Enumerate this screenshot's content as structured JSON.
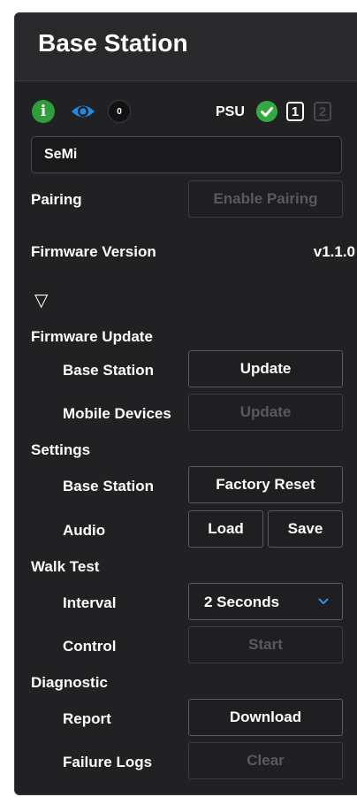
{
  "header": {
    "title": "Base Station"
  },
  "status": {
    "info_icon": "info-icon",
    "eye_icon": "eye-icon",
    "badge_count": "0",
    "psu_label": "PSU",
    "psu_status_icon": "check-circle-icon",
    "psu_1": "1",
    "psu_2": "2",
    "colors": {
      "info": "#2e9d3a",
      "eye": "#1e88e5",
      "ok": "#35a83f"
    }
  },
  "name_field": {
    "value": "SeMi"
  },
  "pairing": {
    "label": "Pairing",
    "button": "Enable Pairing"
  },
  "firmware": {
    "label": "Firmware Version",
    "value": "v1.1.0"
  },
  "expand_icon": "▽",
  "firmware_update": {
    "label": "Firmware Update",
    "base_station_label": "Base Station",
    "base_station_button": "Update",
    "mobile_label": "Mobile Devices",
    "mobile_button": "Update"
  },
  "settings": {
    "label": "Settings",
    "base_station_label": "Base Station",
    "factory_reset": "Factory Reset",
    "audio_label": "Audio",
    "load": "Load",
    "save": "Save"
  },
  "walk_test": {
    "label": "Walk Test",
    "interval_label": "Interval",
    "interval_value": "2 Seconds",
    "control_label": "Control",
    "start": "Start"
  },
  "diagnostic": {
    "label": "Diagnostic",
    "report_label": "Report",
    "download": "Download",
    "failure_logs_label": "Failure Logs",
    "clear": "Clear"
  }
}
